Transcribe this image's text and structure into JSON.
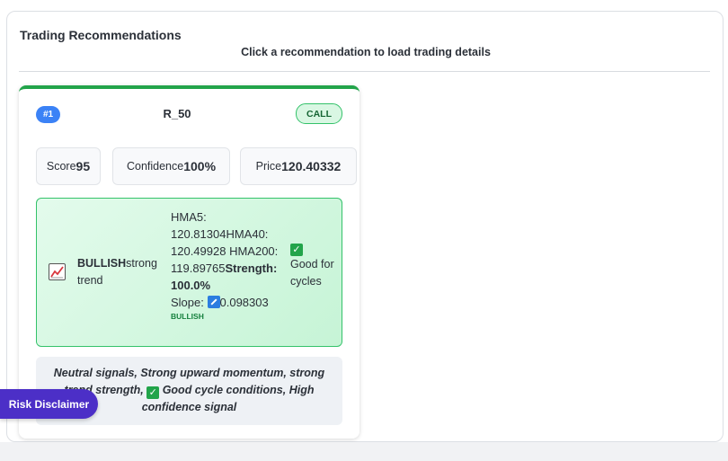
{
  "panel": {
    "title": "Trading Recommendations",
    "subtitle": "Click a recommendation to load trading details"
  },
  "recommendation": {
    "rank": "#1",
    "symbol": "R_50",
    "direction": "CALL",
    "stats": {
      "score_label": "Score",
      "score_value": "95",
      "confidence_label": "Confidence",
      "confidence_value": "100%",
      "price_label": "Price",
      "price_value": "120.40332"
    },
    "trend": {
      "direction": "BULLISH",
      "strength_text": "strong trend",
      "hma5_label": "HMA5:",
      "hma5_value": "120.81304",
      "hma40_label": "HMA40:",
      "hma40_value": "120.49928",
      "hma200_label": "HMA200:",
      "hma200_value": "119.89765",
      "strength_label": "Strength:",
      "strength_value": "100.0%",
      "slope_label": "Slope:",
      "slope_value": "0.098303",
      "slope_direction": "BULLISH",
      "cycle_text": "Good for cycles"
    },
    "reasons": {
      "part1": "Neutral signals, Strong upward momentum, strong trend strength,",
      "part2": "Good cycle conditions, High confidence signal"
    }
  },
  "disclaimer_button": "Risk Disclaimer",
  "colors": {
    "accent_green": "#22a44a",
    "rank_blue": "#3b82f6",
    "disclaimer_purple": "#4c2fc7"
  },
  "icons": {
    "trend": "chart-increasing-icon",
    "slope": "arrow-up-right-icon",
    "check": "check-mark-icon"
  }
}
